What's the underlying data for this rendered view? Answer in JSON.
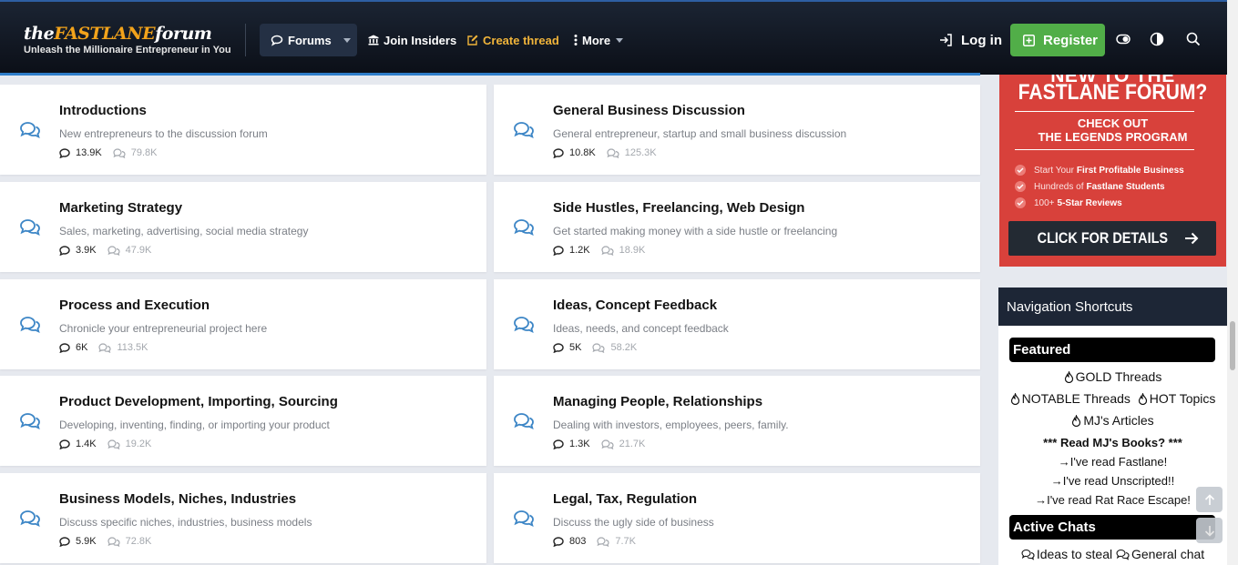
{
  "header": {
    "logo_prefix": "the",
    "logo_highlight": "FASTLANE",
    "logo_suffix": "forum",
    "logo_tagline": "Unleash the Millionaire Entrepreneur in You",
    "nav": {
      "forums": "Forums",
      "insiders": "Join Insiders",
      "create": "Create thread",
      "more": "More"
    },
    "login": "Log in",
    "register": "Register"
  },
  "forums": [
    {
      "title": "Introductions",
      "desc": "New entrepreneurs to the discussion forum",
      "threads": "13.9K",
      "messages": "79.8K"
    },
    {
      "title": "General Business Discussion",
      "desc": "General entrepreneur, startup and small business discussion",
      "threads": "10.8K",
      "messages": "125.3K"
    },
    {
      "title": "Marketing Strategy",
      "desc": "Sales, marketing, advertising, social media strategy",
      "threads": "3.9K",
      "messages": "47.9K"
    },
    {
      "title": "Side Hustles, Freelancing, Web Design",
      "desc": "Get started making money with a side hustle or freelancing",
      "threads": "1.2K",
      "messages": "18.9K"
    },
    {
      "title": "Process and Execution",
      "desc": "Chronicle your entrepreneurial project here",
      "threads": "6K",
      "messages": "113.5K"
    },
    {
      "title": "Ideas, Concept Feedback",
      "desc": "Ideas, needs, and concept feedback",
      "threads": "5K",
      "messages": "58.2K"
    },
    {
      "title": "Product Development, Importing, Sourcing",
      "desc": "Developing, inventing, finding, or importing your product",
      "threads": "1.4K",
      "messages": "19.2K"
    },
    {
      "title": "Managing People, Relationships",
      "desc": "Dealing with investors, employees, peers, family.",
      "threads": "1.3K",
      "messages": "21.7K"
    },
    {
      "title": "Business Models, Niches, Industries",
      "desc": "Discuss specific niches, industries, business models",
      "threads": "5.9K",
      "messages": "72.8K"
    },
    {
      "title": "Legal, Tax, Regulation",
      "desc": "Discuss the ugly side of business",
      "threads": "803",
      "messages": "7.7K"
    }
  ],
  "promo": {
    "top_cut": "NEW TO THE",
    "headline": "FASTLANE FORUM?",
    "check_line1": "CHECK OUT",
    "check_line2": "THE LEGENDS PROGRAM",
    "items": [
      {
        "pre": "Start Your",
        "bold": "First Profitable Business"
      },
      {
        "pre": "Hundreds of",
        "bold": "Fastlane Students"
      },
      {
        "pre": "100+",
        "bold": "5-Star Reviews"
      }
    ],
    "cta": "CLICK FOR DETAILS"
  },
  "shortcuts": {
    "heading": "Navigation Shortcuts",
    "featured_label": "Featured",
    "gold": "GOLD Threads",
    "notable": "NOTABLE Threads",
    "hot": "HOT Topics",
    "articles": "MJ's Articles",
    "books_heading": "*** Read MJ's Books? ***",
    "book1": "→I've read Fastlane!",
    "book2": "→I've read Unscripted!!",
    "book3": "→I've read Rat Race Escape!",
    "active_label": "Active Chats",
    "ideas": "Ideas to steal",
    "general": "General chat"
  },
  "colors": {
    "accent_blue": "#2f7dc8",
    "register_green": "#51ae48",
    "create_gold": "#f0b43a",
    "promo_red": "#d8413b"
  }
}
